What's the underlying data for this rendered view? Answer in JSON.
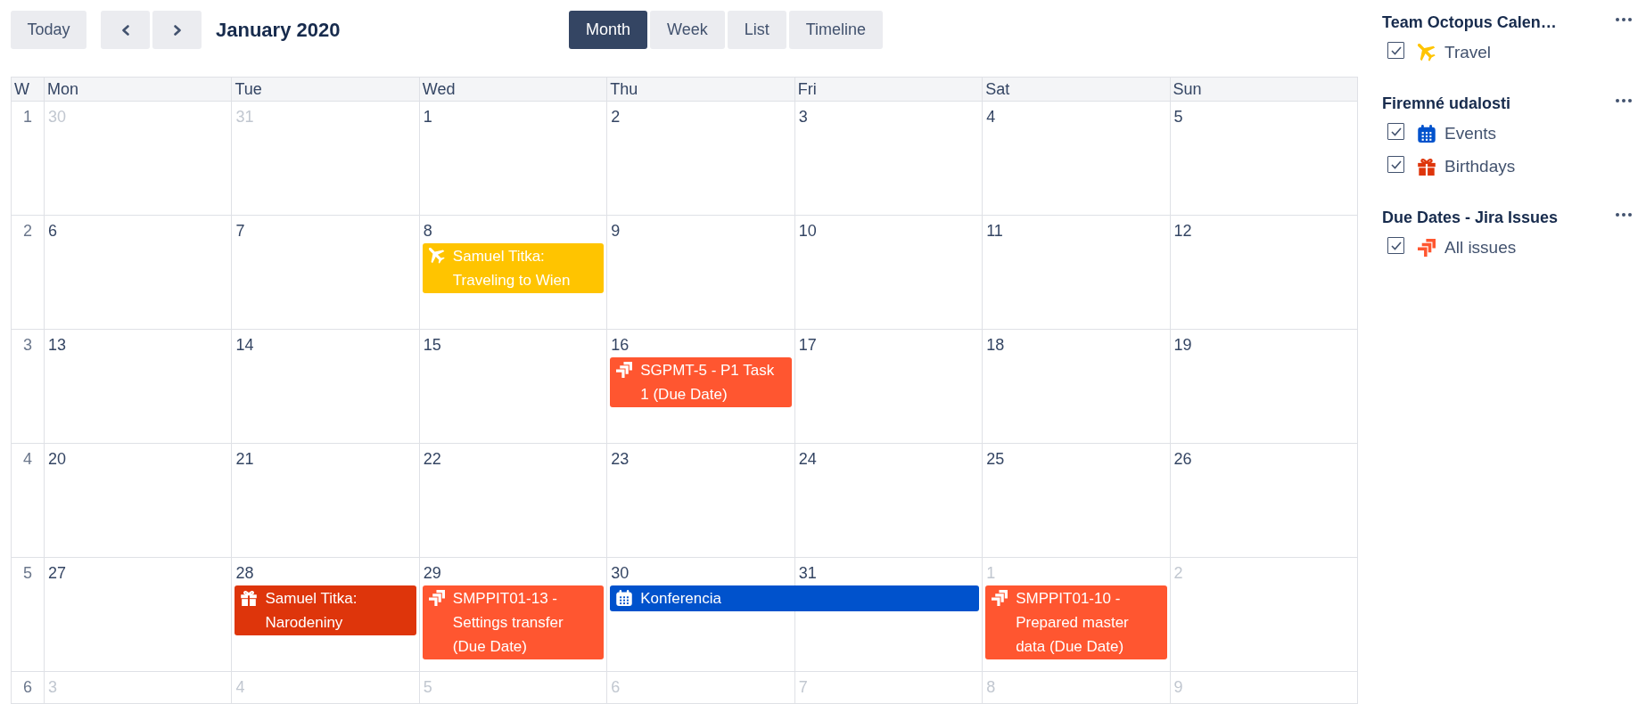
{
  "toolbar": {
    "today": "Today",
    "title": "January 2020",
    "views": [
      {
        "label": "Month",
        "selected": true
      },
      {
        "label": "Week",
        "selected": false
      },
      {
        "label": "List",
        "selected": false
      },
      {
        "label": "Timeline",
        "selected": false
      }
    ]
  },
  "calendar": {
    "week_heading": "W",
    "weekdays": [
      "Mon",
      "Tue",
      "Wed",
      "Thu",
      "Fri",
      "Sat",
      "Sun"
    ],
    "weeks": [
      {
        "number": "1",
        "days": [
          {
            "date": "30",
            "other_month": true
          },
          {
            "date": "31",
            "other_month": true
          },
          {
            "date": "1",
            "other_month": false
          },
          {
            "date": "2",
            "other_month": false
          },
          {
            "date": "3",
            "other_month": false
          },
          {
            "date": "4",
            "other_month": false
          },
          {
            "date": "5",
            "other_month": false
          }
        ]
      },
      {
        "number": "2",
        "days": [
          {
            "date": "6",
            "other_month": false
          },
          {
            "date": "7",
            "other_month": false
          },
          {
            "date": "8",
            "other_month": false,
            "events": [
              {
                "title": "Samuel Titka: Traveling to Wien",
                "kind": "travel",
                "color": "#ffc400",
                "continues": false
              }
            ]
          },
          {
            "date": "9",
            "other_month": false
          },
          {
            "date": "10",
            "other_month": false
          },
          {
            "date": "11",
            "other_month": false
          },
          {
            "date": "12",
            "other_month": false
          }
        ]
      },
      {
        "number": "3",
        "days": [
          {
            "date": "13",
            "other_month": false
          },
          {
            "date": "14",
            "other_month": false
          },
          {
            "date": "15",
            "other_month": false
          },
          {
            "date": "16",
            "other_month": false,
            "events": [
              {
                "title": "SGPMT-5 - P1 Task 1 (Due Date)",
                "kind": "issue",
                "color": "#ff5630",
                "continues": false
              }
            ]
          },
          {
            "date": "17",
            "other_month": false
          },
          {
            "date": "18",
            "other_month": false
          },
          {
            "date": "19",
            "other_month": false
          }
        ]
      },
      {
        "number": "4",
        "days": [
          {
            "date": "20",
            "other_month": false
          },
          {
            "date": "21",
            "other_month": false
          },
          {
            "date": "22",
            "other_month": false
          },
          {
            "date": "23",
            "other_month": false
          },
          {
            "date": "24",
            "other_month": false
          },
          {
            "date": "25",
            "other_month": false
          },
          {
            "date": "26",
            "other_month": false
          }
        ]
      },
      {
        "number": "5",
        "days": [
          {
            "date": "27",
            "other_month": false
          },
          {
            "date": "28",
            "other_month": false,
            "events": [
              {
                "title": "Samuel Titka: Narodeniny",
                "kind": "birthday",
                "color": "#de350b",
                "continues": false
              }
            ]
          },
          {
            "date": "29",
            "other_month": false,
            "events": [
              {
                "title": "SMPPIT01-13 - Settings transfer (Due Date)",
                "kind": "issue",
                "color": "#ff5630",
                "continues": false
              }
            ]
          },
          {
            "date": "30",
            "other_month": false,
            "events": [
              {
                "title": "Konferencia",
                "kind": "event",
                "color": "#0052cc",
                "continues": true
              }
            ]
          },
          {
            "date": "31",
            "other_month": false
          },
          {
            "date": "1",
            "other_month": true,
            "events": [
              {
                "title": "SMPPIT01-10 - Prepared master data (Due Date)",
                "kind": "issue",
                "color": "#ff5630",
                "continues": false
              }
            ]
          },
          {
            "date": "2",
            "other_month": true
          }
        ]
      },
      {
        "number": "6",
        "days": [
          {
            "date": "3",
            "other_month": true
          },
          {
            "date": "4",
            "other_month": true
          },
          {
            "date": "5",
            "other_month": true
          },
          {
            "date": "6",
            "other_month": true
          },
          {
            "date": "7",
            "other_month": true
          },
          {
            "date": "8",
            "other_month": true
          },
          {
            "date": "9",
            "other_month": true
          }
        ]
      }
    ]
  },
  "sidebar": {
    "calendars": [
      {
        "title": "Team Octopus Calen…",
        "items": [
          {
            "label": "Travel",
            "kind": "travel",
            "color": "#ffc400",
            "checked": true
          }
        ]
      },
      {
        "title": "Firemné udalosti",
        "items": [
          {
            "label": "Events",
            "kind": "event",
            "color": "#0052cc",
            "checked": true
          },
          {
            "label": "Birthdays",
            "kind": "birthday",
            "color": "#de350b",
            "checked": true
          }
        ]
      },
      {
        "title": "Due Dates - Jira Issues",
        "items": [
          {
            "label": "All issues",
            "kind": "issue",
            "color": "#ff5630",
            "checked": true
          }
        ]
      }
    ]
  }
}
